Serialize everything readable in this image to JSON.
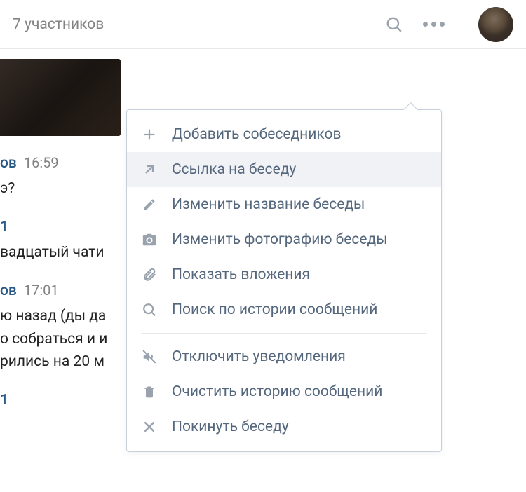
{
  "header": {
    "participants_label": "7 участников"
  },
  "messages": [
    {
      "name_fragment": "ов",
      "time": "16:59",
      "lines": [
        "э?"
      ]
    },
    {
      "name_fragment": "1",
      "time": "",
      "lines": [
        "вадцатый чати"
      ]
    },
    {
      "name_fragment": "ов",
      "time": "17:01",
      "lines": [
        "ю назад (ды да",
        "о собраться и и",
        "рились на 20 м"
      ]
    },
    {
      "name_fragment": "1",
      "time": "",
      "lines": []
    }
  ],
  "menu": {
    "items": [
      {
        "icon": "plus",
        "label": "Добавить собеседников",
        "highlighted": false
      },
      {
        "icon": "arrow-up-right",
        "label": "Ссылка на беседу",
        "highlighted": true
      },
      {
        "icon": "pencil",
        "label": "Изменить название беседы",
        "highlighted": false
      },
      {
        "icon": "camera",
        "label": "Изменить фотографию беседы",
        "highlighted": false
      },
      {
        "icon": "attach",
        "label": "Показать вложения",
        "highlighted": false
      },
      {
        "icon": "search",
        "label": "Поиск по истории сообщений",
        "highlighted": false
      }
    ],
    "items2": [
      {
        "icon": "mute",
        "label": "Отключить уведомления",
        "highlighted": false
      },
      {
        "icon": "trash",
        "label": "Очистить историю сообщений",
        "highlighted": false
      },
      {
        "icon": "close",
        "label": "Покинуть беседу",
        "highlighted": false
      }
    ]
  }
}
